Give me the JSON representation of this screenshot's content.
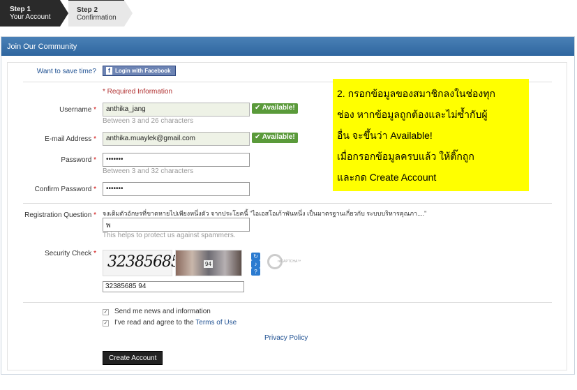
{
  "steps": [
    {
      "num": "Step 1",
      "name": "Your Account"
    },
    {
      "num": "Step 2",
      "name": "Confirmation"
    }
  ],
  "panel": {
    "title": "Join Our Community"
  },
  "facebook": {
    "prompt": "Want to save time?",
    "button_label": "Login with Facebook",
    "icon": "f"
  },
  "form": {
    "required_info": "* Required Information",
    "username": {
      "label": "Username",
      "star": "*",
      "value": "anthika_jang",
      "hint": "Between 3 and 26 characters",
      "status": "✔ Available!"
    },
    "email": {
      "label": "E-mail Address",
      "star": "*",
      "value": "anthika.muaylek@gmail.com",
      "status": "✔ Available!"
    },
    "password": {
      "label": "Password",
      "star": "*",
      "value": "•••••••",
      "hint": "Between 3 and 32 characters"
    },
    "confirm_password": {
      "label": "Confirm Password",
      "star": "*",
      "value": "•••••••"
    },
    "registration_question": {
      "label": "Registration Question",
      "star": "*",
      "question": "จงเติมตัวอักษรที่ขาดหายไปเพียงหนึ่งตัว จากประโยคนี้ \"ไอเอสโอเก้าพันหนึ่ง เป็นมาตรฐานเกี่ยวกับ ระบบบริหารคุณภา....\"",
      "value": "พ",
      "hint": "This helps to protect us against spammers."
    },
    "security_check": {
      "label": "Security Check",
      "star": "*",
      "captcha_text": "32385685",
      "captcha_small": "94",
      "value": "32385685 94",
      "recaptcha_label": "reCAPTCHA™"
    },
    "news": {
      "label": "Send me news and information",
      "checked": "✓"
    },
    "terms": {
      "label": "I've read and agree to the ",
      "link": "Terms of Use",
      "checked": "✓"
    },
    "privacy_link": "Privacy Policy",
    "submit_label": "Create Account"
  },
  "note": {
    "line1": "2. กรอกข้อมูลของสมาชิกลงในช่องทุก",
    "line2": "ช่อง หากข้อมูลถูกต้องและไม่ซ้ำกับผู้",
    "line3": "อื่น จะขึ้นว่า Available!",
    "line4": "เมื่อกรอกข้อมูลครบแล้ว ให้ติ๊กถูก",
    "line5": "และกด Create Account",
    "color": "#ffff00"
  },
  "colors": {
    "header": "#3a72ab",
    "available": "#5a9a3a",
    "required": "#cc0000",
    "link": "#1d4f91"
  }
}
